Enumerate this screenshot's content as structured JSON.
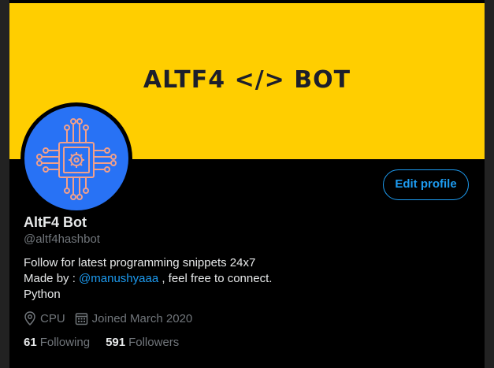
{
  "banner": {
    "text": "ALTF4 </> BOT",
    "bg_color": "#ffce00",
    "text_color": "#1d1f2b"
  },
  "avatar": {
    "icon": "chip-gear-icon",
    "bg_color": "#2872f5",
    "accent": "#f2a08a"
  },
  "edit_profile": {
    "label": "Edit profile"
  },
  "profile": {
    "name": "AltF4 Bot",
    "handle": "@altf4hashbot",
    "bio_line1": "Follow for latest programming snippets 24x7",
    "bio_made_by": "Made by : ",
    "bio_mention": "@manushyaaa",
    "bio_suffix": " , feel free to connect.",
    "bio_line3": "Python"
  },
  "meta": {
    "location": "CPU",
    "joined": "Joined March 2020"
  },
  "stats": {
    "following_count": "61",
    "following_label": "Following",
    "followers_count": "591",
    "followers_label": "Followers"
  },
  "colors": {
    "accent": "#1d9bf0",
    "text": "#e7e9ea",
    "muted": "#71767b"
  }
}
